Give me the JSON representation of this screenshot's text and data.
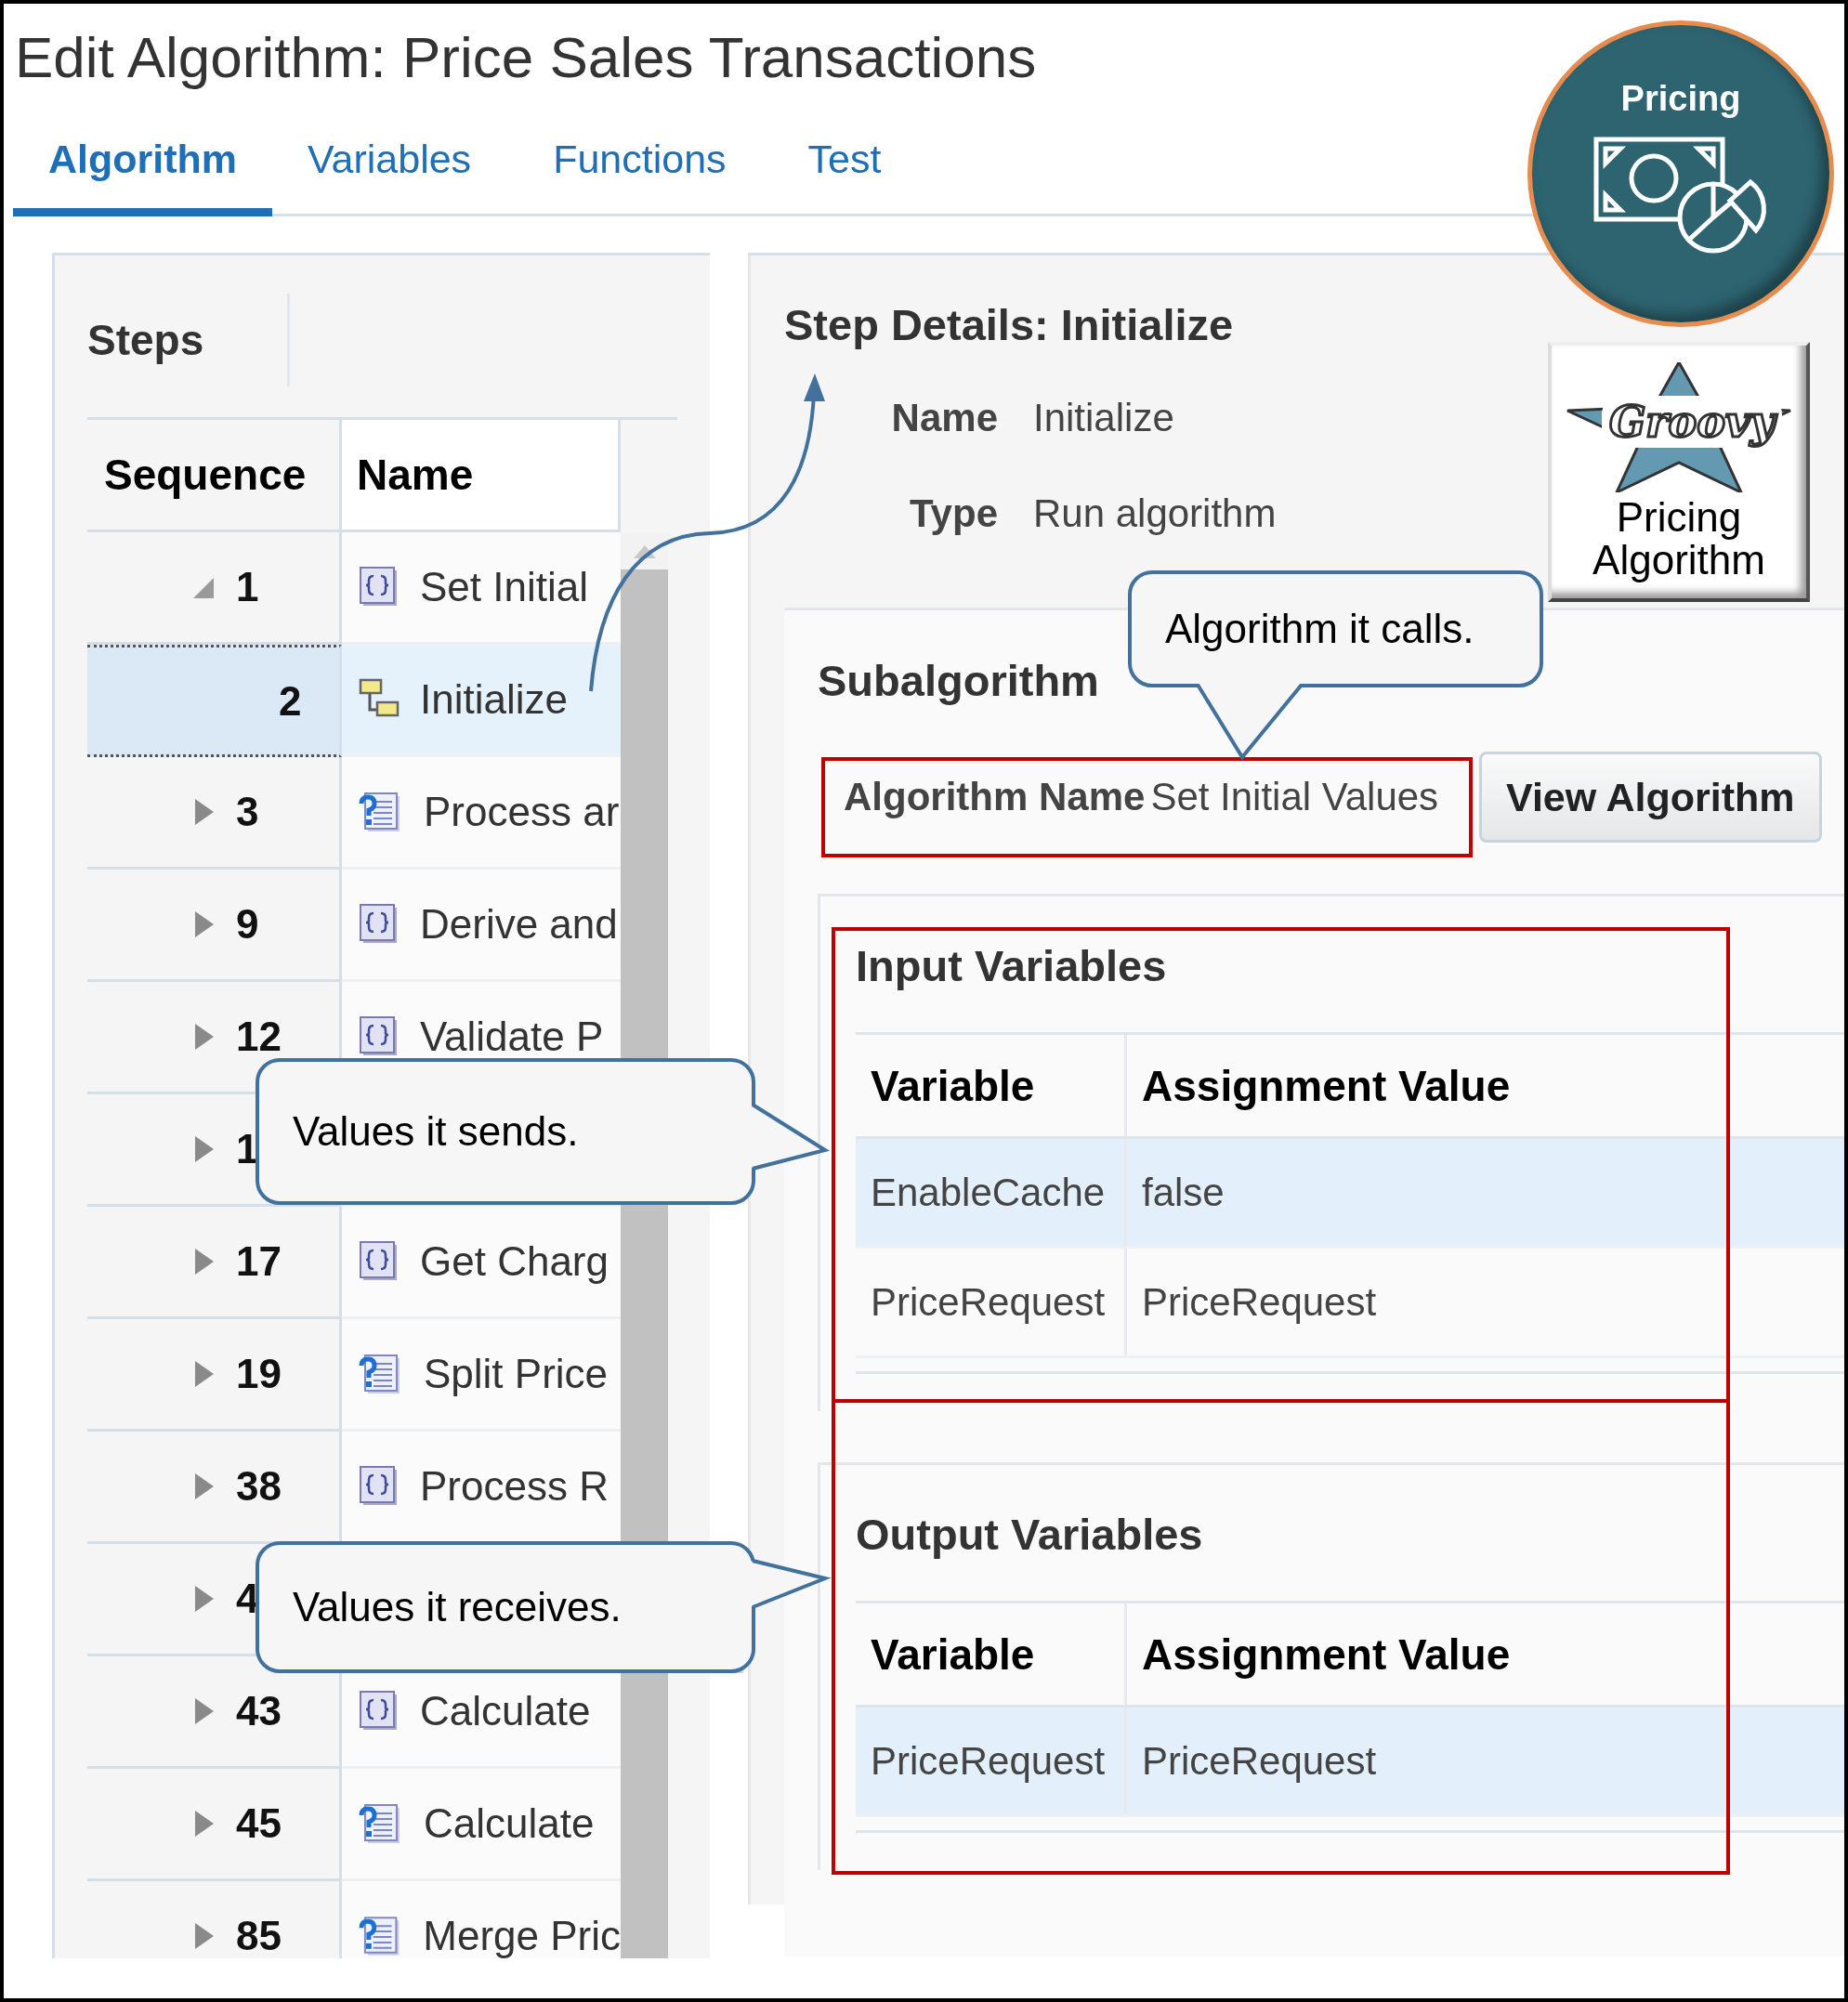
{
  "title": "Edit Algorithm: Price Sales Transactions",
  "tabs": [
    {
      "label": "Algorithm",
      "selected": true
    },
    {
      "label": "Variables",
      "selected": false
    },
    {
      "label": "Functions",
      "selected": false
    },
    {
      "label": "Test",
      "selected": false
    }
  ],
  "badge": {
    "label": "Pricing"
  },
  "steps": {
    "title": "Steps",
    "columns": [
      "Sequence",
      "Name"
    ],
    "rows": [
      {
        "sequence": "1",
        "name": "Set Initial",
        "kind": "code",
        "expanded": true,
        "selected": false,
        "children": [
          {
            "sequence": "2",
            "name": "Initialize",
            "kind": "subalgorithm",
            "selected": true
          }
        ]
      },
      {
        "sequence": "3",
        "name": "Process ar",
        "kind": "condition",
        "expanded": false,
        "selected": false
      },
      {
        "sequence": "9",
        "name": "Derive and",
        "kind": "code",
        "expanded": false,
        "selected": false
      },
      {
        "sequence": "12",
        "name": "Validate P",
        "kind": "code",
        "expanded": false,
        "selected": false
      },
      {
        "sequence": "1",
        "expanded": false,
        "selected": false
      },
      {
        "sequence": "17",
        "name": "Get Charg",
        "kind": "code",
        "expanded": false,
        "selected": false
      },
      {
        "sequence": "19",
        "name": "Split Price",
        "kind": "condition",
        "expanded": false,
        "selected": false
      },
      {
        "sequence": "38",
        "name": "Process R",
        "kind": "code",
        "expanded": false,
        "selected": false
      },
      {
        "sequence": "4",
        "expanded": false,
        "selected": false
      },
      {
        "sequence": "43",
        "name": "Calculate",
        "kind": "code",
        "expanded": false,
        "selected": false
      },
      {
        "sequence": "45",
        "name": "Calculate",
        "kind": "condition",
        "expanded": false,
        "selected": false
      },
      {
        "sequence": "85",
        "name": "Merge Pric",
        "kind": "condition",
        "expanded": false,
        "selected": false
      }
    ]
  },
  "step_details": {
    "title": "Step Details: Initialize",
    "fields": [
      {
        "label": "Name",
        "value": "Initialize"
      },
      {
        "label": "Type",
        "value": "Run algorithm"
      }
    ]
  },
  "logo_card": {
    "logo": "Groovy",
    "caption": "Pricing Algorithm"
  },
  "subalgorithm": {
    "title": "Subalgorithm",
    "field": {
      "label": "Algorithm Name",
      "value": "Set Initial Values"
    },
    "button": "View Algorithm"
  },
  "input_variables": {
    "title": "Input Variables",
    "columns": [
      "Variable",
      "Assignment Value"
    ],
    "rows": [
      {
        "variable": "EnableCache",
        "value": "false",
        "selected": true
      },
      {
        "variable": "PriceRequest",
        "value": "PriceRequest",
        "selected": false
      }
    ]
  },
  "output_variables": {
    "title": "Output Variables",
    "columns": [
      "Variable",
      "Assignment Value"
    ],
    "rows": [
      {
        "variable": "PriceRequest",
        "value": "PriceRequest",
        "selected": true
      }
    ]
  },
  "callouts": [
    {
      "text": "Algorithm it calls."
    },
    {
      "text": "Values it sends."
    },
    {
      "text": "Values it receives."
    }
  ]
}
